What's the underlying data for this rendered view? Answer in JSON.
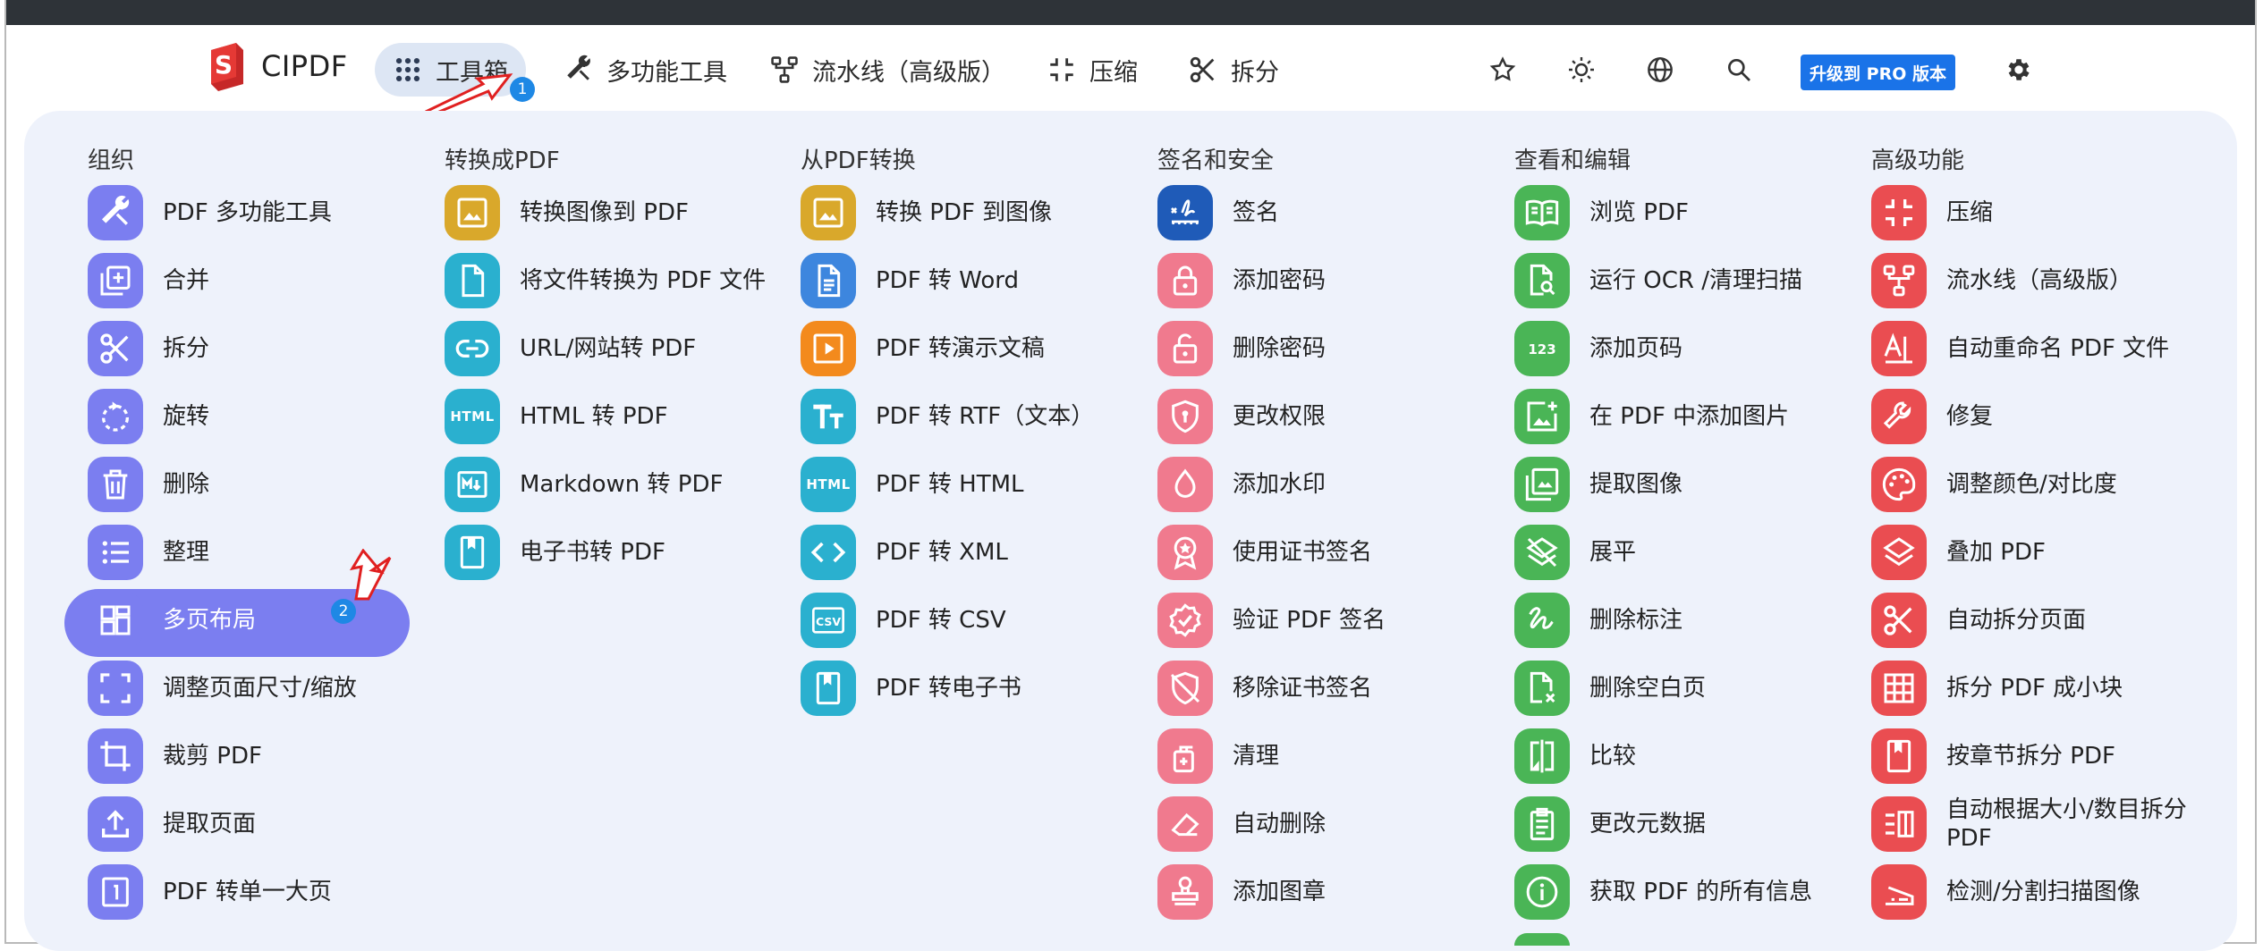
{
  "app": {
    "name": "CIPDF"
  },
  "nav": {
    "tabs": [
      {
        "label": "工具箱",
        "icon": "grid-icon",
        "badge": "1"
      },
      {
        "label": "多功能工具",
        "icon": "tools-icon"
      },
      {
        "label": "流水线（高级版）",
        "icon": "pipeline-icon"
      },
      {
        "label": "压缩",
        "icon": "compress-icon"
      },
      {
        "label": "拆分",
        "icon": "scissors-icon"
      }
    ],
    "right_icons": [
      "star-icon",
      "sun-icon",
      "globe-icon",
      "search-icon",
      "gear-icon"
    ],
    "pro_button": "升级到 PRO 版本"
  },
  "colors": {
    "accent": "#7b7ef0",
    "pro": "#1a73e8",
    "badge": "#1e88e5"
  },
  "columns": [
    {
      "title": "组织",
      "items": [
        {
          "label": "PDF 多功能工具",
          "icon": "tools-icon",
          "color": "purple"
        },
        {
          "label": "合并",
          "icon": "merge-icon",
          "color": "purple"
        },
        {
          "label": "拆分",
          "icon": "scissors-icon",
          "color": "purple"
        },
        {
          "label": "旋转",
          "icon": "rotate-icon",
          "color": "purple"
        },
        {
          "label": "删除",
          "icon": "trash-icon",
          "color": "purple"
        },
        {
          "label": "整理",
          "icon": "list-icon",
          "color": "purple"
        },
        {
          "label": "多页布局",
          "icon": "dashboard-icon",
          "color": "purple",
          "selected": true,
          "badge": "2"
        },
        {
          "label": "调整页面尺寸/缩放",
          "icon": "fullscreen-icon",
          "color": "purple"
        },
        {
          "label": "裁剪 PDF",
          "icon": "crop-icon",
          "color": "purple"
        },
        {
          "label": "提取页面",
          "icon": "upload-icon",
          "color": "purple"
        },
        {
          "label": "PDF 转单一大页",
          "icon": "single-page-icon",
          "color": "purple"
        }
      ]
    },
    {
      "title": "转换成PDF",
      "items": [
        {
          "label": "转换图像到 PDF",
          "icon": "image-icon",
          "color": "yellow"
        },
        {
          "label": "将文件转换为 PDF 文件",
          "icon": "file-icon",
          "color": "teal"
        },
        {
          "label": "URL/网站转 PDF",
          "icon": "link-icon",
          "color": "teal"
        },
        {
          "label": "HTML 转 PDF",
          "icon": "html-icon",
          "color": "teal"
        },
        {
          "label": "Markdown 转 PDF",
          "icon": "markdown-icon",
          "color": "teal"
        },
        {
          "label": "电子书转 PDF",
          "icon": "book-icon",
          "color": "teal"
        }
      ]
    },
    {
      "title": "从PDF转换",
      "items": [
        {
          "label": "转换 PDF 到图像",
          "icon": "image-icon",
          "color": "yellow"
        },
        {
          "label": "PDF 转 Word",
          "icon": "document-icon",
          "color": "blue"
        },
        {
          "label": "PDF 转演示文稿",
          "icon": "slideshow-icon",
          "color": "orange"
        },
        {
          "label": "PDF 转 RTF（文本）",
          "icon": "text-icon",
          "color": "teal"
        },
        {
          "label": "PDF 转 HTML",
          "icon": "html-icon",
          "color": "teal"
        },
        {
          "label": "PDF 转 XML",
          "icon": "code-icon",
          "color": "teal"
        },
        {
          "label": "PDF 转 CSV",
          "icon": "csv-icon",
          "color": "teal"
        },
        {
          "label": "PDF 转电子书",
          "icon": "book-icon",
          "color": "teal"
        }
      ]
    },
    {
      "title": "签名和安全",
      "items": [
        {
          "label": "签名",
          "icon": "signature-icon",
          "color": "navy"
        },
        {
          "label": "添加密码",
          "icon": "lock-icon",
          "color": "pink"
        },
        {
          "label": "删除密码",
          "icon": "unlock-icon",
          "color": "pink"
        },
        {
          "label": "更改权限",
          "icon": "shield-icon",
          "color": "pink"
        },
        {
          "label": "添加水印",
          "icon": "water-drop-icon",
          "color": "pink"
        },
        {
          "label": "使用证书签名",
          "icon": "award-icon",
          "color": "pink"
        },
        {
          "label": "验证 PDF 签名",
          "icon": "verified-icon",
          "color": "pink"
        },
        {
          "label": "移除证书签名",
          "icon": "shield-off-icon",
          "color": "pink"
        },
        {
          "label": "清理",
          "icon": "sanitizer-icon",
          "color": "pink"
        },
        {
          "label": "自动删除",
          "icon": "eraser-icon",
          "color": "pink"
        },
        {
          "label": "添加图章",
          "icon": "stamp-icon",
          "color": "pink"
        }
      ]
    },
    {
      "title": "查看和编辑",
      "items": [
        {
          "label": "浏览 PDF",
          "icon": "book-open-icon",
          "color": "green"
        },
        {
          "label": "运行 OCR /清理扫描",
          "icon": "search-doc-icon",
          "color": "green"
        },
        {
          "label": "添加页码",
          "icon": "numbers-icon",
          "color": "green"
        },
        {
          "label": "在 PDF 中添加图片",
          "icon": "add-photo-icon",
          "color": "green"
        },
        {
          "label": "提取图像",
          "icon": "photo-library-icon",
          "color": "green"
        },
        {
          "label": "展平",
          "icon": "layers-off-icon",
          "color": "green"
        },
        {
          "label": "删除标注",
          "icon": "gesture-icon",
          "color": "green"
        },
        {
          "label": "删除空白页",
          "icon": "blank-page-icon",
          "color": "green"
        },
        {
          "label": "比较",
          "icon": "compare-icon",
          "color": "green"
        },
        {
          "label": "更改元数据",
          "icon": "clipboard-icon",
          "color": "green"
        },
        {
          "label": "获取 PDF 的所有信息",
          "icon": "info-icon",
          "color": "green"
        }
      ]
    },
    {
      "title": "高级功能",
      "items": [
        {
          "label": "压缩",
          "icon": "compress-icon",
          "color": "red"
        },
        {
          "label": "流水线（高级版）",
          "icon": "pipeline-icon",
          "color": "red"
        },
        {
          "label": "自动重命名 PDF 文件",
          "icon": "rename-icon",
          "color": "red"
        },
        {
          "label": "修复",
          "icon": "wrench-icon",
          "color": "red"
        },
        {
          "label": "调整颜色/对比度",
          "icon": "palette-icon",
          "color": "red"
        },
        {
          "label": "叠加 PDF",
          "icon": "layers-icon",
          "color": "red"
        },
        {
          "label": "自动拆分页面",
          "icon": "scissors-icon",
          "color": "red"
        },
        {
          "label": "拆分 PDF 成小块",
          "icon": "grid-split-icon",
          "color": "red"
        },
        {
          "label": "按章节拆分 PDF",
          "icon": "bookmark-icon",
          "color": "red"
        },
        {
          "label": "自动根据大小/数目拆分 PDF",
          "icon": "split-size-icon",
          "color": "red",
          "wrap": true
        },
        {
          "label": "检测/分割扫描图像",
          "icon": "scanner-icon",
          "color": "red"
        }
      ]
    }
  ]
}
